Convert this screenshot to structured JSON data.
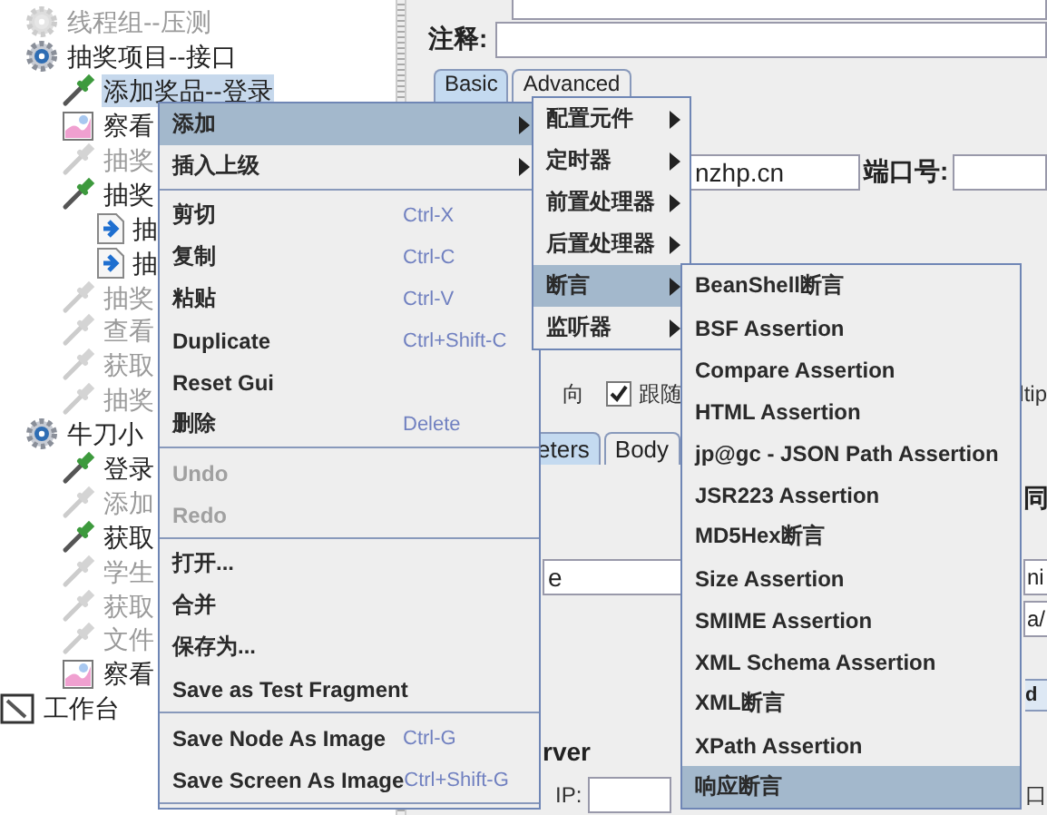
{
  "tree": [
    {
      "label": "线程组--压测",
      "kind": "thread_group",
      "disabled": true,
      "selected": false
    },
    {
      "label": "抽奖项目--接口",
      "kind": "thread_group",
      "disabled": false,
      "selected": false,
      "children": [
        {
          "label": "添加奖品--登录",
          "kind": "sampler",
          "disabled": false,
          "selected": true
        },
        {
          "label": "察看",
          "kind": "listener",
          "disabled": false,
          "selected": false
        },
        {
          "label": "抽奖",
          "kind": "sampler",
          "disabled": true,
          "selected": false
        },
        {
          "label": "抽奖",
          "kind": "sampler",
          "disabled": false,
          "selected": false,
          "children": [
            {
              "label": "抽",
              "kind": "extractor",
              "disabled": false,
              "selected": false
            },
            {
              "label": "抽",
              "kind": "extractor",
              "disabled": false,
              "selected": false
            }
          ]
        },
        {
          "label": "抽奖",
          "kind": "sampler",
          "disabled": true,
          "selected": false
        },
        {
          "label": "查看",
          "kind": "sampler",
          "disabled": true,
          "selected": false
        },
        {
          "label": "获取",
          "kind": "sampler",
          "disabled": true,
          "selected": false
        },
        {
          "label": "抽奖",
          "kind": "sampler",
          "disabled": true,
          "selected": false
        }
      ]
    },
    {
      "label": "牛刀小",
      "kind": "thread_group",
      "disabled": false,
      "selected": false,
      "children": [
        {
          "label": "登录",
          "kind": "sampler",
          "disabled": false,
          "selected": false
        },
        {
          "label": "添加",
          "kind": "sampler",
          "disabled": true,
          "selected": false
        },
        {
          "label": "获取",
          "kind": "sampler",
          "disabled": false,
          "selected": false
        },
        {
          "label": "学生",
          "kind": "sampler",
          "disabled": true,
          "selected": false
        },
        {
          "label": "获取",
          "kind": "sampler",
          "disabled": true,
          "selected": false
        },
        {
          "label": "文件",
          "kind": "sampler",
          "disabled": true,
          "selected": false
        },
        {
          "label": "察看",
          "kind": "listener",
          "disabled": false,
          "selected": false
        }
      ]
    }
  ],
  "workbench": {
    "label": "工作台"
  },
  "editor": {
    "comment_label": "注释:",
    "tabs": [
      {
        "label": "Basic",
        "selected": true
      },
      {
        "label": "Advanced",
        "selected": false
      }
    ],
    "server_value": "nzhp.cn",
    "port_label": "端口号:",
    "redirect_label": "向",
    "follow_redirects": {
      "label": "跟随",
      "checked": true
    },
    "multipart_label": "ltip",
    "param_tabs": [
      {
        "label": "eters",
        "selected": true
      },
      {
        "label": "Body",
        "selected": false
      }
    ],
    "column_fragment": "同",
    "param_value": "e",
    "cell_1": "ni",
    "cell_2": "a/",
    "add_button": "d",
    "group_title": "rver",
    "ip_label": "IP:",
    "port_label_2": "口"
  },
  "context_menu": {
    "groups": [
      [
        {
          "label": "添加",
          "submenu": true,
          "selected": true,
          "disabled": false
        },
        {
          "label": "插入上级",
          "submenu": true,
          "selected": false,
          "disabled": false
        }
      ],
      [
        {
          "label": "剪切",
          "shortcut": "Ctrl-X",
          "submenu": false,
          "selected": false,
          "disabled": false
        },
        {
          "label": "复制",
          "shortcut": "Ctrl-C",
          "submenu": false,
          "selected": false,
          "disabled": false
        },
        {
          "label": "粘贴",
          "shortcut": "Ctrl-V",
          "submenu": false,
          "selected": false,
          "disabled": false
        },
        {
          "label": "Duplicate",
          "shortcut": "Ctrl+Shift-C",
          "submenu": false,
          "selected": false,
          "disabled": false
        },
        {
          "label": "Reset Gui",
          "submenu": false,
          "selected": false,
          "disabled": false
        },
        {
          "label": "删除",
          "shortcut": "Delete",
          "submenu": false,
          "selected": false,
          "disabled": false
        }
      ],
      [
        {
          "label": "Undo",
          "submenu": false,
          "selected": false,
          "disabled": true
        },
        {
          "label": "Redo",
          "submenu": false,
          "selected": false,
          "disabled": true
        }
      ],
      [
        {
          "label": "打开...",
          "submenu": false,
          "selected": false,
          "disabled": false
        },
        {
          "label": "合并",
          "submenu": false,
          "selected": false,
          "disabled": false
        },
        {
          "label": "保存为...",
          "submenu": false,
          "selected": false,
          "disabled": false
        },
        {
          "label": "Save as Test Fragment",
          "submenu": false,
          "selected": false,
          "disabled": false
        }
      ],
      [
        {
          "label": "Save Node As Image",
          "shortcut": "Ctrl-G",
          "submenu": false,
          "selected": false,
          "disabled": false
        },
        {
          "label": "Save Screen As Image",
          "shortcut": "Ctrl+Shift-G",
          "submenu": false,
          "selected": false,
          "disabled": false
        }
      ]
    ]
  },
  "add_submenu": [
    {
      "label": "配置元件",
      "submenu": true,
      "selected": false
    },
    {
      "label": "定时器",
      "submenu": true,
      "selected": false
    },
    {
      "label": "前置处理器",
      "submenu": true,
      "selected": false
    },
    {
      "label": "后置处理器",
      "submenu": true,
      "selected": false
    },
    {
      "label": "断言",
      "submenu": true,
      "selected": true
    },
    {
      "label": "监听器",
      "submenu": true,
      "selected": false
    }
  ],
  "assertion_submenu": [
    {
      "label": "BeanShell断言",
      "selected": false
    },
    {
      "label": "BSF Assertion",
      "selected": false
    },
    {
      "label": "Compare Assertion",
      "selected": false
    },
    {
      "label": "HTML Assertion",
      "selected": false
    },
    {
      "label": "jp@gc - JSON Path Assertion",
      "selected": false
    },
    {
      "label": "JSR223 Assertion",
      "selected": false
    },
    {
      "label": "MD5Hex断言",
      "selected": false
    },
    {
      "label": "Size Assertion",
      "selected": false
    },
    {
      "label": "SMIME Assertion",
      "selected": false
    },
    {
      "label": "XML Schema Assertion",
      "selected": false
    },
    {
      "label": "XML断言",
      "selected": false
    },
    {
      "label": "XPath Assertion",
      "selected": false
    },
    {
      "label": "响应断言",
      "selected": true
    }
  ]
}
